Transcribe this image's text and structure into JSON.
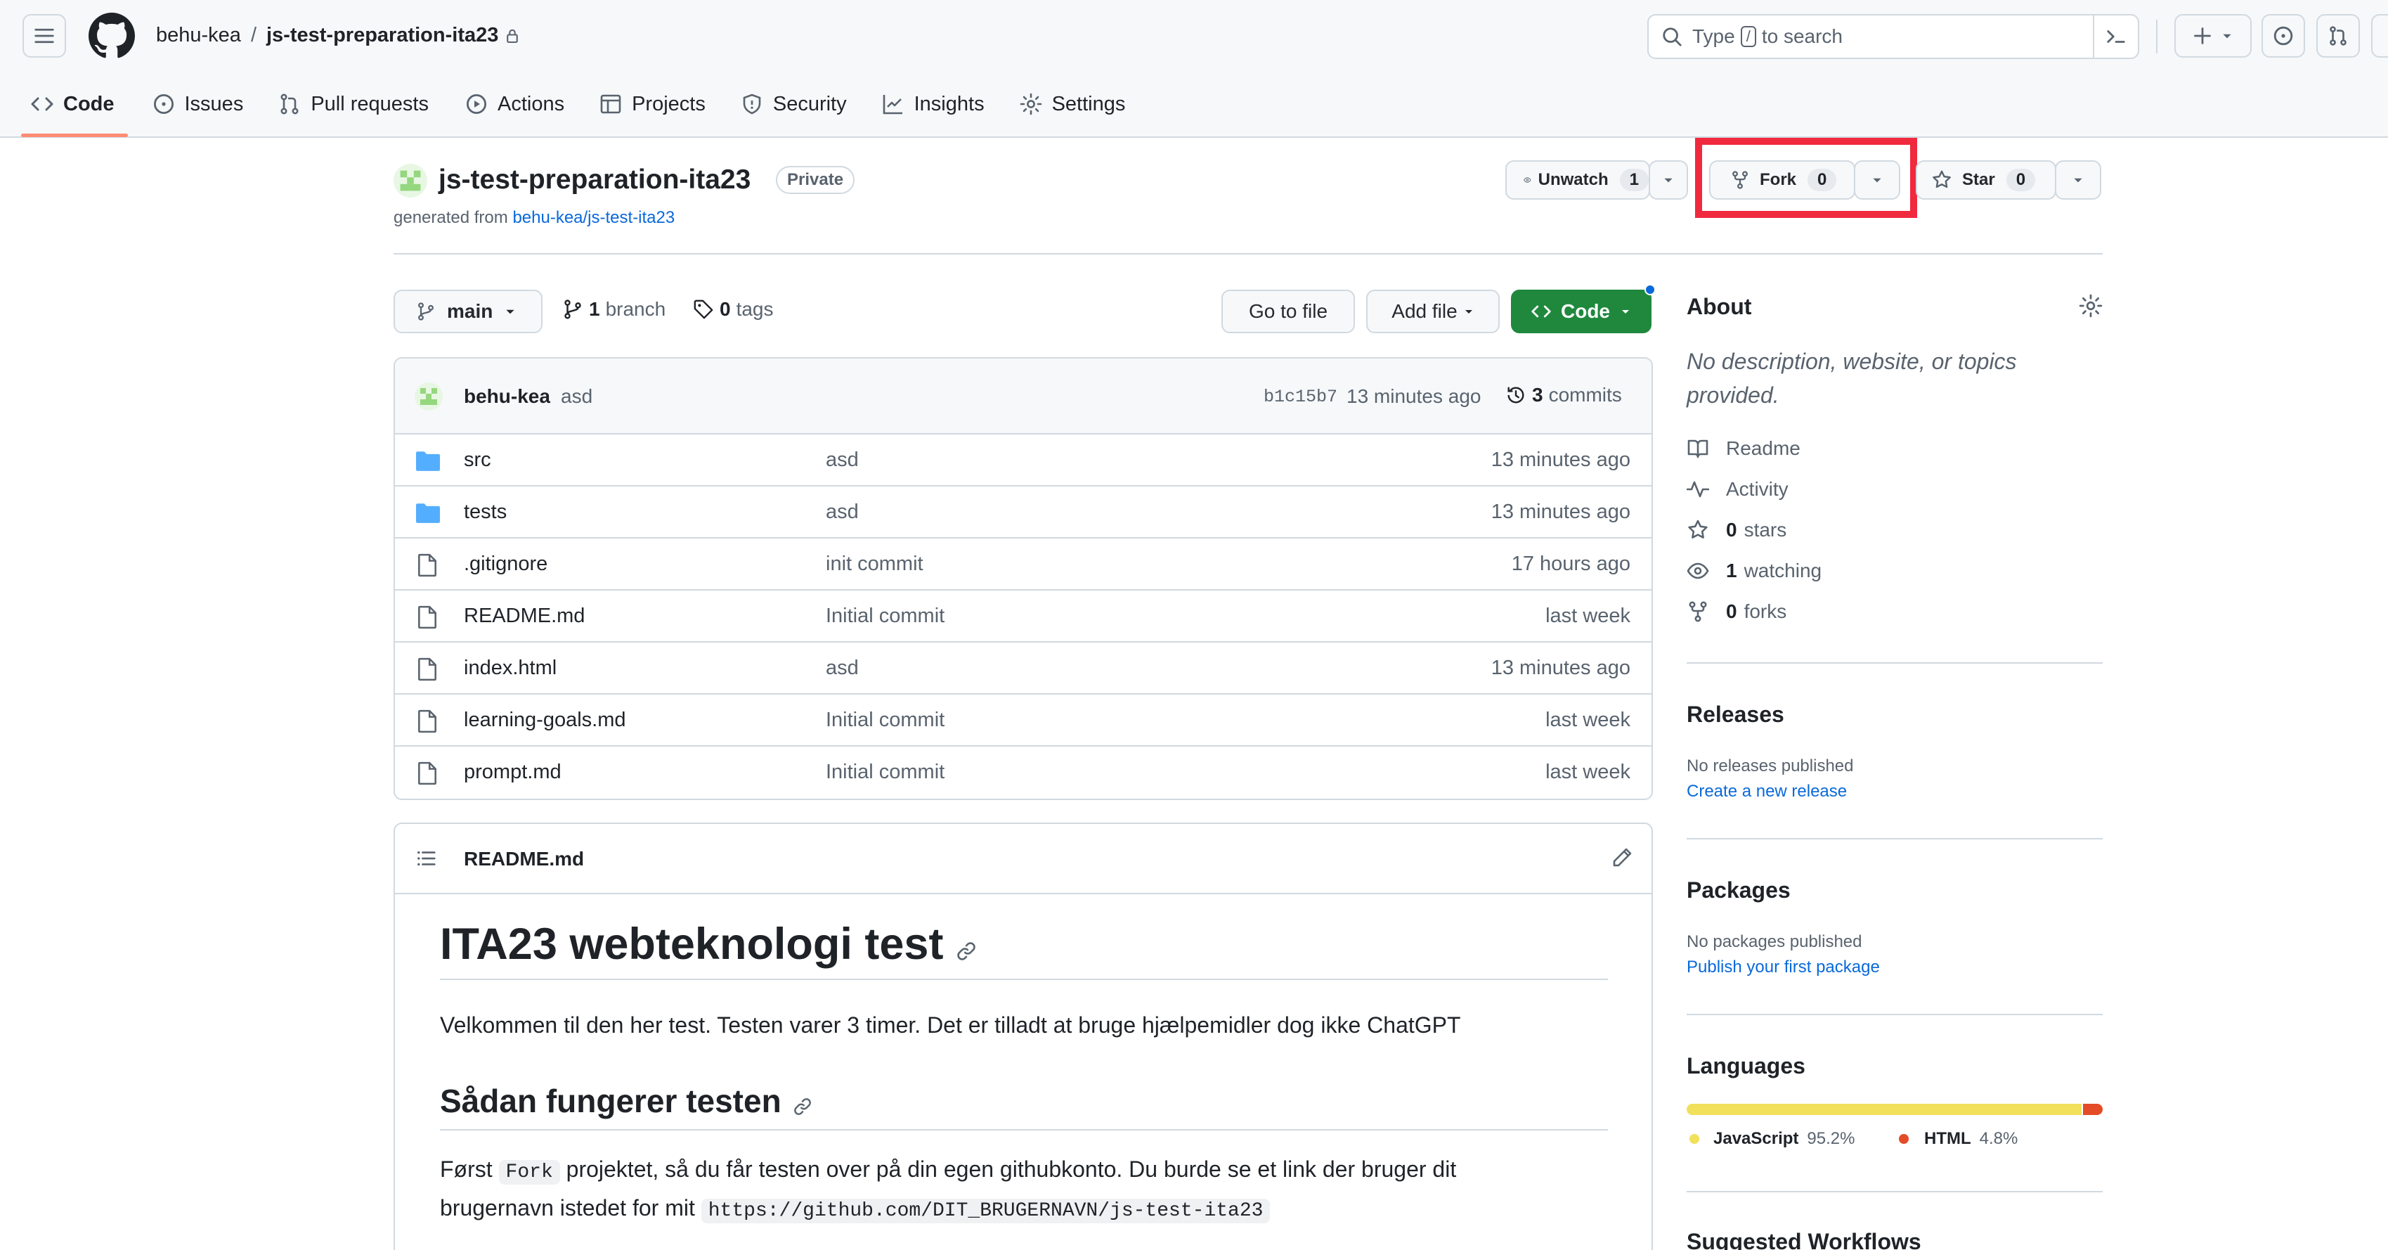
{
  "header": {
    "owner": "behu-kea",
    "separator": "/",
    "repo": "js-test-preparation-ita23",
    "search_prefix": "Type",
    "search_key": "/",
    "search_suffix": "to search"
  },
  "nav": {
    "tabs": [
      {
        "label": "Code"
      },
      {
        "label": "Issues"
      },
      {
        "label": "Pull requests"
      },
      {
        "label": "Actions"
      },
      {
        "label": "Projects"
      },
      {
        "label": "Security"
      },
      {
        "label": "Insights"
      },
      {
        "label": "Settings"
      }
    ]
  },
  "repo": {
    "name": "js-test-preparation-ita23",
    "visibility": "Private",
    "generated_from_label": "generated from",
    "generated_from_link": "behu-kea/js-test-ita23",
    "unwatch_label": "Unwatch",
    "watch_count": "1",
    "fork_label": "Fork",
    "fork_count": "0",
    "star_label": "Star",
    "star_count": "0"
  },
  "toolbar": {
    "branch": "main",
    "branch_count": "1",
    "branch_label": "branch",
    "tag_count": "0",
    "tag_label": "tags",
    "go_to_file": "Go to file",
    "add_file": "Add file",
    "code": "Code"
  },
  "commit": {
    "author": "behu-kea",
    "message": "asd",
    "hash": "b1c15b7",
    "time": "13 minutes ago",
    "commits_count": "3",
    "commits_label": "commits"
  },
  "files": [
    {
      "type": "folder",
      "name": "src",
      "message": "asd",
      "time": "13 minutes ago"
    },
    {
      "type": "folder",
      "name": "tests",
      "message": "asd",
      "time": "13 minutes ago"
    },
    {
      "type": "file",
      "name": ".gitignore",
      "message": "init commit",
      "time": "17 hours ago"
    },
    {
      "type": "file",
      "name": "README.md",
      "message": "Initial commit",
      "time": "last week"
    },
    {
      "type": "file",
      "name": "index.html",
      "message": "asd",
      "time": "13 minutes ago"
    },
    {
      "type": "file",
      "name": "learning-goals.md",
      "message": "Initial commit",
      "time": "last week"
    },
    {
      "type": "file",
      "name": "prompt.md",
      "message": "Initial commit",
      "time": "last week"
    }
  ],
  "readme": {
    "filename": "README.md",
    "h1": "ITA23 webteknologi test",
    "intro": "Velkommen til den her test. Testen varer 3 timer. Det er tilladt at bruge hjælpemidler dog ikke ChatGPT",
    "h2": "Sådan fungerer testen",
    "p2_a": "Først",
    "p2_code1": "Fork",
    "p2_b": "projektet, så du får testen over på din egen githubkonto. Du burde se et link der bruger dit",
    "p2_c": "brugernavn istedet for mit",
    "p2_code2": "https://github.com/DIT_BRUGERNAVN/js-test-ita23"
  },
  "about": {
    "title": "About",
    "description": "No description, website, or topics provided.",
    "readme": "Readme",
    "activity": "Activity",
    "stars_count": "0",
    "stars_label": "stars",
    "watching_count": "1",
    "watching_label": "watching",
    "forks_count": "0",
    "forks_label": "forks"
  },
  "releases": {
    "title": "Releases",
    "empty": "No releases published",
    "link": "Create a new release"
  },
  "packages": {
    "title": "Packages",
    "empty": "No packages published",
    "link": "Publish your first package"
  },
  "languages": {
    "title": "Languages",
    "items": [
      {
        "name": "JavaScript",
        "percent": "95.2%",
        "color": "#f1e05a",
        "share": 0.952
      },
      {
        "name": "HTML",
        "percent": "4.8%",
        "color": "#e34c26",
        "share": 0.048
      }
    ]
  },
  "suggested": {
    "title": "Suggested Workflows"
  },
  "colors": {
    "accent_green": "#1f883d",
    "highlight_red": "#f0293e",
    "link_blue": "#0969da",
    "folder_blue": "#54aeff"
  }
}
